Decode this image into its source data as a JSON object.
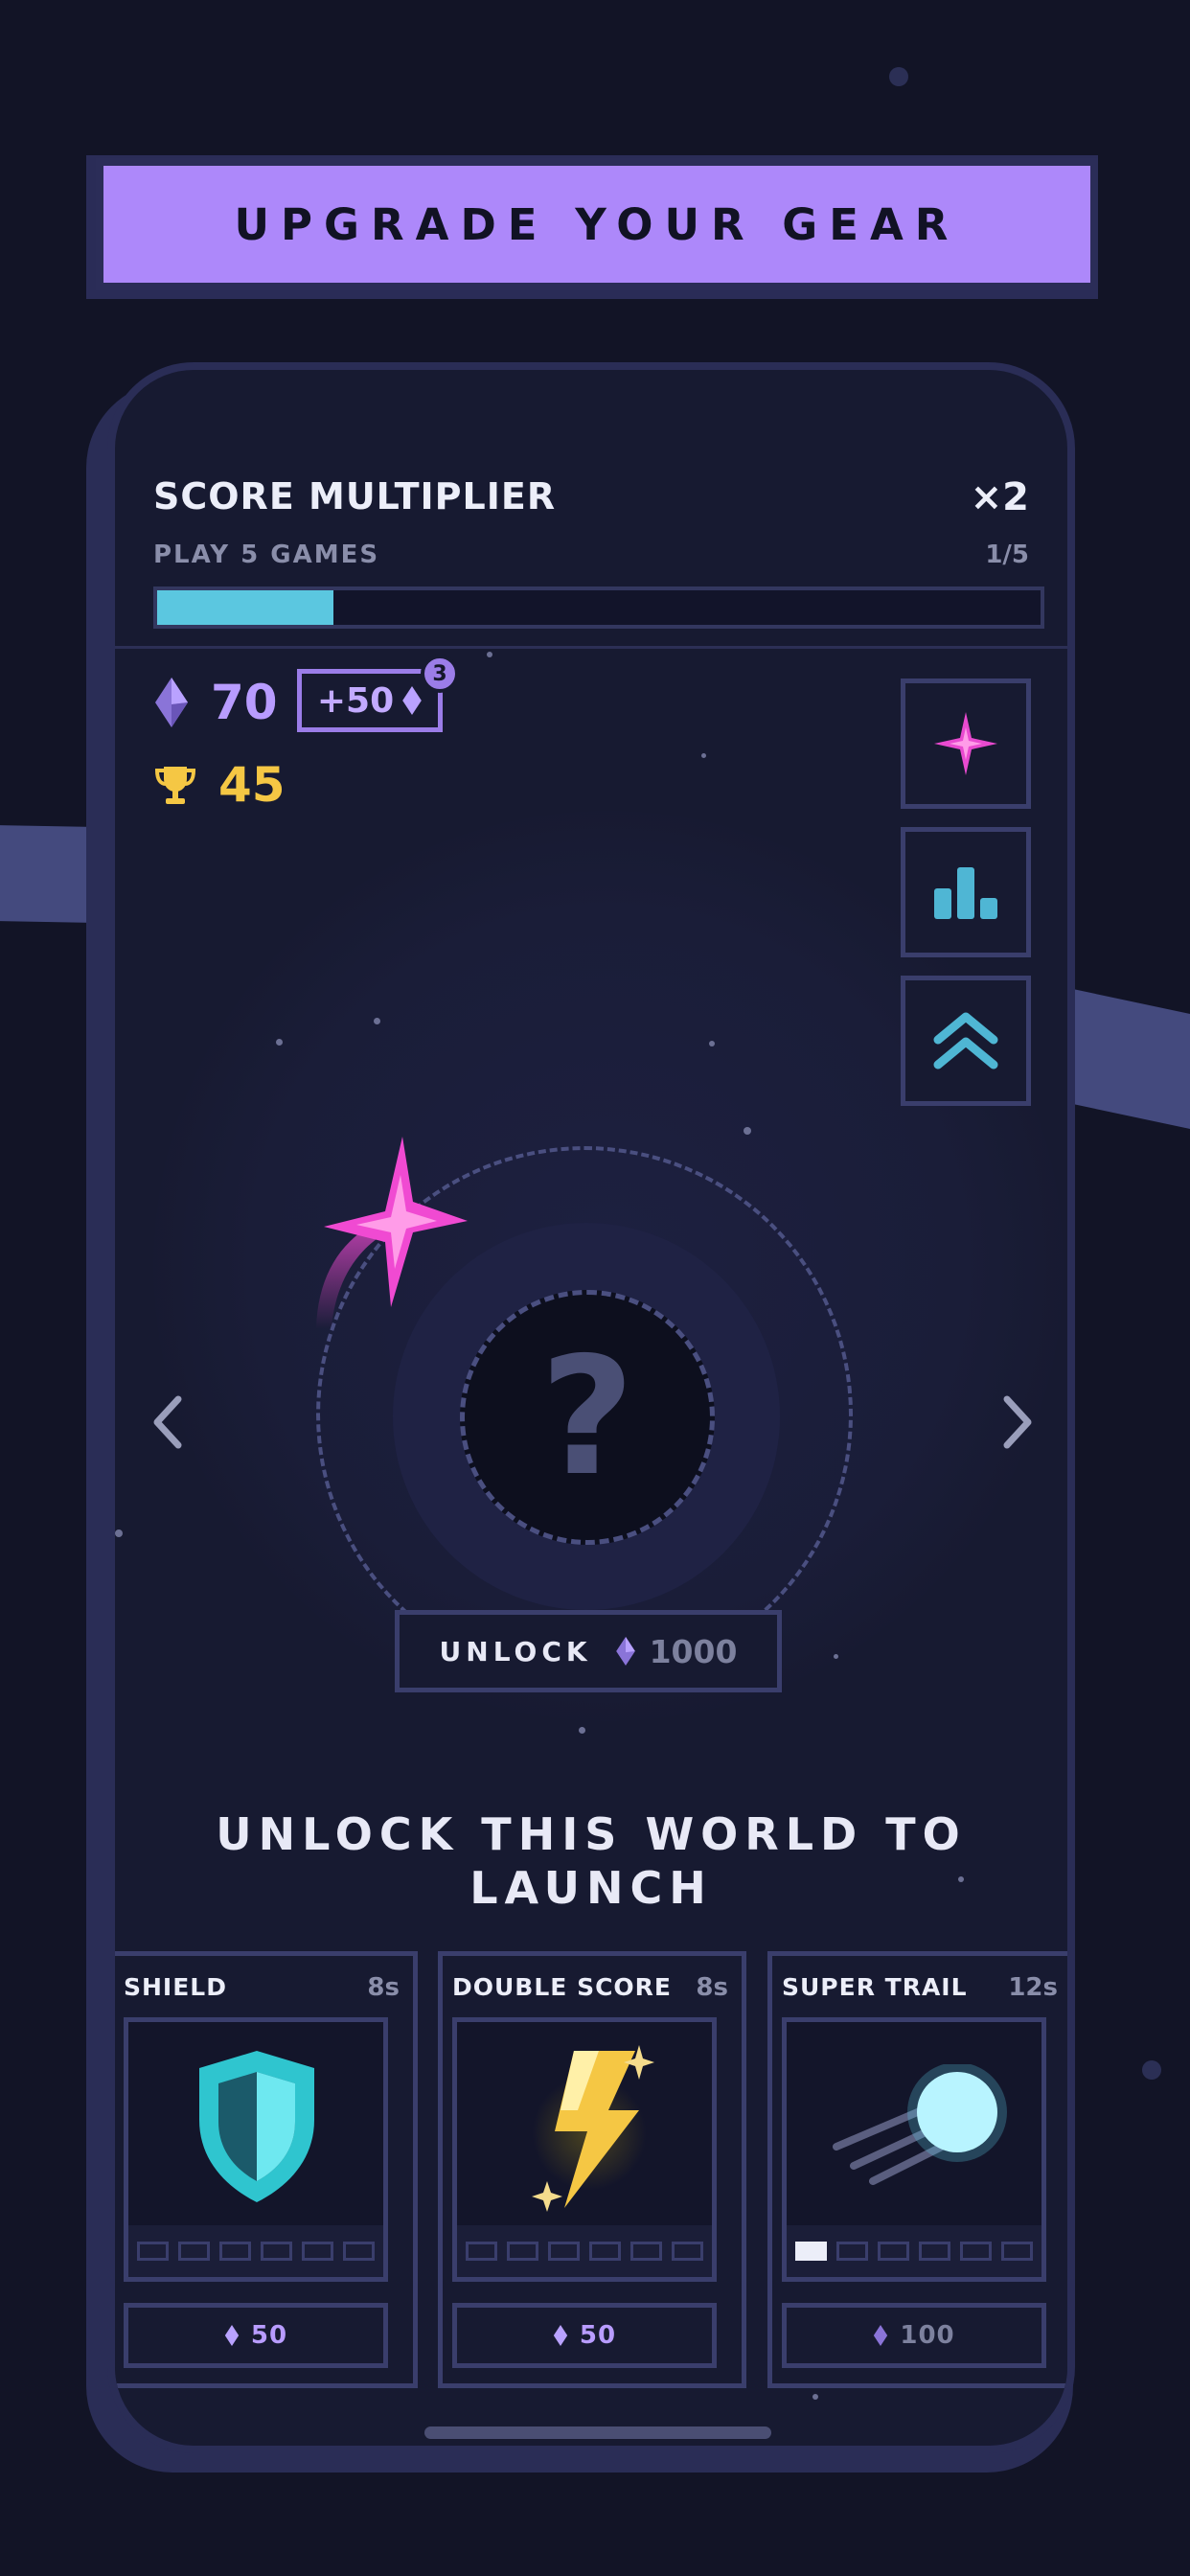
{
  "banner": {
    "title": "UPGRADE YOUR GEAR"
  },
  "multiplier": {
    "title": "SCORE MULTIPLIER",
    "value": "×2",
    "task": "PLAY 5 GAMES",
    "progress_text": "1/5",
    "progress_fraction": 0.2
  },
  "currency": {
    "gems": "70",
    "bonus": "+50",
    "bonus_badge": "3",
    "trophies": "45"
  },
  "side_buttons": [
    {
      "icon": "sparkle-icon"
    },
    {
      "icon": "leaderboard-icon"
    },
    {
      "icon": "double-chevron-up-icon"
    }
  ],
  "world": {
    "unlock_label": "UNLOCK",
    "unlock_price": "1000",
    "headline_line1": "UNLOCK THIS WORLD TO",
    "headline_line2": "LAUNCH",
    "mystery_symbol": "?"
  },
  "powerups": [
    {
      "name": "SHIELD",
      "duration": "8s",
      "price": "50",
      "level": 0,
      "max_level": 6,
      "icon": "shield-icon"
    },
    {
      "name": "DOUBLE SCORE",
      "duration": "8s",
      "price": "50",
      "level": 0,
      "max_level": 6,
      "icon": "lightning-icon"
    },
    {
      "name": "SUPER TRAIL",
      "duration": "12s",
      "price": "100",
      "level": 1,
      "max_level": 6,
      "icon": "comet-icon"
    }
  ],
  "colors": {
    "background": "#121426",
    "accent_purple": "#ad88fa",
    "progress_cyan": "#5bc7e0",
    "gem_purple": "#b89cff",
    "trophy_gold": "#f5c744",
    "star_pink": "#f04ad2"
  }
}
